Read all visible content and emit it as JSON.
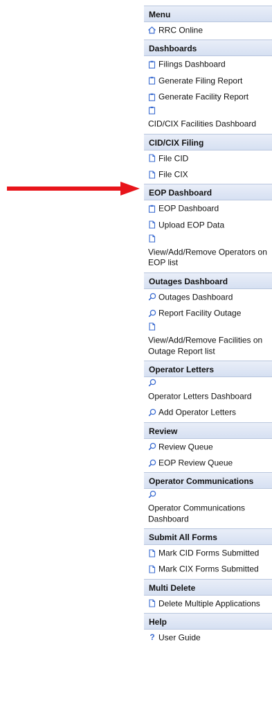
{
  "colors": {
    "arrow": "#e8151b",
    "icon": "#3a6bd0"
  },
  "sections": [
    {
      "title": "Menu",
      "items": [
        {
          "label": "RRC Online",
          "icon": "home-icon",
          "wrap": false
        }
      ]
    },
    {
      "title": "Dashboards",
      "items": [
        {
          "label": "Filings Dashboard",
          "icon": "clipboard-icon",
          "wrap": false
        },
        {
          "label": "Generate Filing Report",
          "icon": "clipboard-icon",
          "wrap": false
        },
        {
          "label": "Generate Facility Report",
          "icon": "clipboard-icon",
          "wrap": false
        },
        {
          "label": "CID/CIX Facilities Dashboard",
          "icon": "clipboard-icon",
          "wrap": true
        }
      ]
    },
    {
      "title": "CID/CIX Filing",
      "items": [
        {
          "label": "File CID",
          "icon": "document-icon",
          "wrap": false
        },
        {
          "label": "File CIX",
          "icon": "document-icon",
          "wrap": false
        }
      ]
    },
    {
      "title": "EOP Dashboard",
      "items": [
        {
          "label": "EOP Dashboard",
          "icon": "clipboard-icon",
          "wrap": false
        },
        {
          "label": "Upload EOP Data",
          "icon": "document-icon",
          "wrap": false
        },
        {
          "label": "View/Add/Remove Operators on EOP list",
          "icon": "document-icon",
          "wrap": true
        }
      ]
    },
    {
      "title": "Outages Dashboard",
      "items": [
        {
          "label": "Outages Dashboard",
          "icon": "search-icon",
          "wrap": false
        },
        {
          "label": "Report Facility Outage",
          "icon": "search-icon",
          "wrap": false
        },
        {
          "label": "View/Add/Remove Facilities on Outage Report list",
          "icon": "document-icon",
          "wrap": true
        }
      ]
    },
    {
      "title": "Operator Letters",
      "items": [
        {
          "label": "Operator Letters Dashboard",
          "icon": "search-icon",
          "wrap": true
        },
        {
          "label": "Add Operator Letters",
          "icon": "search-icon",
          "wrap": false
        }
      ]
    },
    {
      "title": "Review",
      "items": [
        {
          "label": "Review Queue",
          "icon": "search-icon",
          "wrap": false
        },
        {
          "label": "EOP Review Queue",
          "icon": "search-icon",
          "wrap": false
        }
      ]
    },
    {
      "title": "Operator Communications",
      "items": [
        {
          "label": "Operator Communications Dashboard",
          "icon": "search-icon",
          "wrap": true
        }
      ]
    },
    {
      "title": "Submit All Forms",
      "items": [
        {
          "label": "Mark CID Forms Submitted",
          "icon": "document-icon",
          "wrap": false
        },
        {
          "label": "Mark CIX Forms Submitted",
          "icon": "document-icon",
          "wrap": false
        }
      ]
    },
    {
      "title": "Multi Delete",
      "items": [
        {
          "label": "Delete Multiple Applications",
          "icon": "document-icon",
          "wrap": false
        }
      ]
    },
    {
      "title": "Help",
      "items": [
        {
          "label": "User Guide",
          "icon": "help-icon",
          "wrap": false
        }
      ]
    }
  ]
}
